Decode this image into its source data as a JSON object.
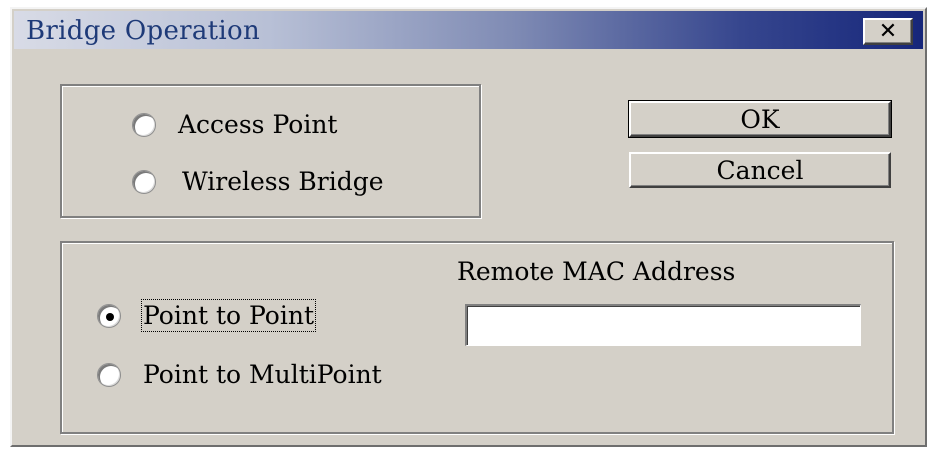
{
  "window": {
    "title": "Bridge Operation",
    "close_label": "✕"
  },
  "mode_group": {
    "options": [
      {
        "label": "Access Point",
        "checked": false
      },
      {
        "label": "Wireless Bridge",
        "checked": false
      }
    ]
  },
  "buttons": {
    "ok_label": "OK",
    "cancel_label": "Cancel"
  },
  "bridge_group": {
    "options": [
      {
        "label": "Point to Point",
        "checked": true
      },
      {
        "label": "Point to MultiPoint",
        "checked": false
      }
    ],
    "remote_mac_label": "Remote MAC Address",
    "remote_mac_value": ""
  },
  "icons": {
    "close": "close-icon"
  }
}
